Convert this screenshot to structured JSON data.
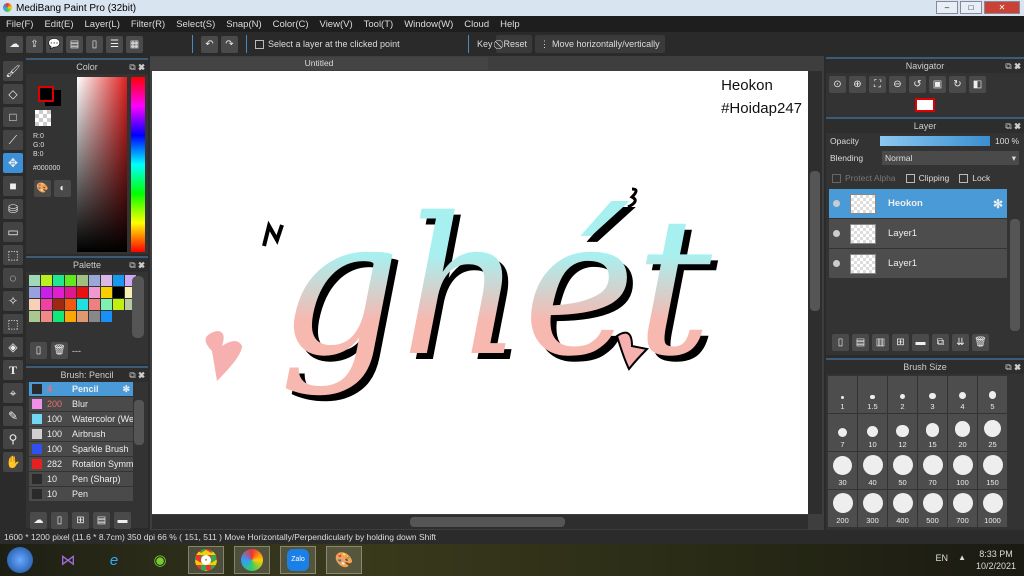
{
  "window": {
    "title": "MediBang Paint Pro (32bit)"
  },
  "menu": [
    "File(F)",
    "Edit(E)",
    "Layer(L)",
    "Filter(R)",
    "Select(S)",
    "Snap(N)",
    "Color(C)",
    "View(V)",
    "Tool(T)",
    "Window(W)",
    "Cloud",
    "Help"
  ],
  "toolbar": {
    "select_layer_label": "Select a layer at the clicked point",
    "key_label": "Key",
    "reset_label": "Reset",
    "move_label": "Move horizontally/vertically"
  },
  "color_panel": {
    "title": "Color",
    "r": "R:0",
    "g": "G:0",
    "b": "B:0",
    "hex": "#000000"
  },
  "palette_panel": {
    "title": "Palette",
    "name": "---",
    "colors": [
      "#a0d8b8",
      "#b8f020",
      "#20e890",
      "#60e820",
      "#a0c080",
      "#98a8d8",
      "#d8b8e8",
      "#1898f0",
      "#d0a8f8",
      "#98a0e0",
      "#c820e8",
      "#e020d0",
      "#e01890",
      "#e81010",
      "#f098d0",
      "#f8d000",
      "#000000",
      "#f8f0b0",
      "#f8d0b8",
      "#f040a0",
      "#a02810",
      "#f05810",
      "#20e0e0",
      "#f08080",
      "#80f0b0",
      "#c0f010",
      "#b8c8a0",
      "#a8c890",
      "#f08888",
      "#10e878",
      "#f8a800",
      "#e09870",
      "#888888",
      "#1890f8"
    ]
  },
  "brush_panel": {
    "title": "Brush: Pencil",
    "brushes": [
      {
        "size": "4",
        "name": "Pencil",
        "color": "#2a2a2a"
      },
      {
        "size": "200",
        "name": "Blur",
        "color": "#f090e8"
      },
      {
        "size": "100",
        "name": "Watercolor (Wet)",
        "color": "#70d8f0"
      },
      {
        "size": "100",
        "name": "Airbrush",
        "color": "#d0d0d0"
      },
      {
        "size": "100",
        "name": "Sparkle Brush",
        "color": "#3050f0"
      },
      {
        "size": "282",
        "name": "Rotation Symmetry",
        "color": "#e82020"
      },
      {
        "size": "10",
        "name": "Pen (Sharp)",
        "color": "#2a2a2a"
      },
      {
        "size": "10",
        "name": "Pen",
        "color": "#2a2a2a"
      }
    ]
  },
  "document": {
    "tab": "Untitled",
    "watermark_line1": "Heokon",
    "watermark_line2": "#Hoidap247",
    "artwork_text": "ghét"
  },
  "navigator": {
    "title": "Navigator"
  },
  "layer_panel": {
    "title": "Layer",
    "opacity_label": "Opacity",
    "opacity_value": "100 %",
    "opacity": 100,
    "blending_label": "Blending",
    "blending_value": "Normal",
    "protect_alpha": "Protect Alpha",
    "clipping": "Clipping",
    "lock": "Lock",
    "layers": [
      {
        "name": "Heokon",
        "selected": true
      },
      {
        "name": "Layer1",
        "selected": false
      },
      {
        "name": "Layer1",
        "selected": false
      }
    ]
  },
  "brush_size_panel": {
    "title": "Brush Size",
    "sizes": [
      "1",
      "1.5",
      "2",
      "3",
      "4",
      "5",
      "7",
      "10",
      "12",
      "15",
      "20",
      "25",
      "30",
      "40",
      "50",
      "70",
      "100",
      "150",
      "200",
      "300",
      "400",
      "500",
      "700",
      "1000"
    ]
  },
  "status": {
    "text": "1600 * 1200 pixel   (11.6 * 8.7cm)   350 dpi   66 %   ( 151, 511 )   Move Horizontally/Perpendicularly by holding down Shift"
  },
  "taskbar": {
    "lang": "EN",
    "time": "8:33 PM",
    "date": "10/2/2021"
  }
}
